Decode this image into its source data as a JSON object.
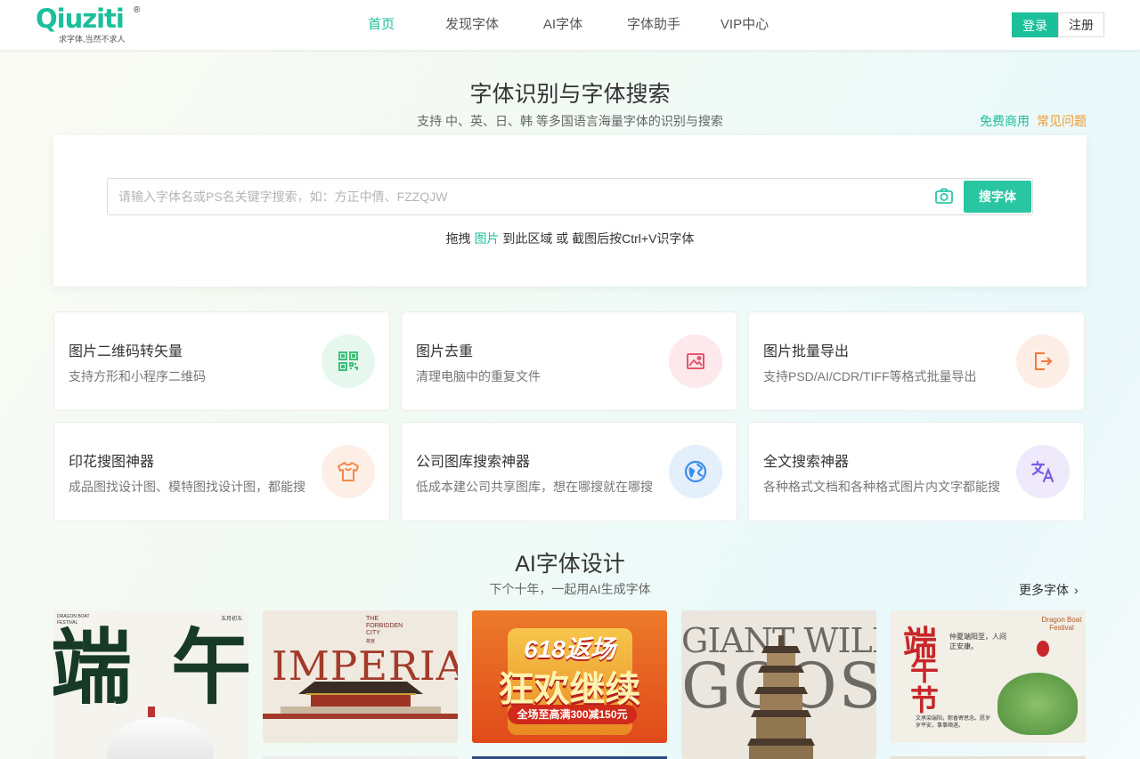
{
  "header": {
    "logo_text": "Qiuziti",
    "logo_reg": "®",
    "logo_slogan": "求字体,当然不求人",
    "nav": [
      {
        "label": "首页",
        "active": true
      },
      {
        "label": "发现字体",
        "active": false
      },
      {
        "label": "AI字体",
        "active": false
      },
      {
        "label": "字体助手",
        "active": false
      },
      {
        "label": "VIP中心",
        "active": false
      }
    ],
    "login_label": "登录",
    "register_label": "注册"
  },
  "hero": {
    "title": "字体识别与字体搜索",
    "subtitle": "支持 中、英、日、韩 等多国语言海量字体的识别与搜索",
    "free_link": "免费商用",
    "faq_link": "常见问题",
    "search_placeholder": "请输入字体名或PS名关键字搜索，如：方正中倩、FZZQJW",
    "search_button": "搜字体",
    "drag_pre": "拖拽",
    "drag_link": "图片",
    "drag_post": "到此区域 或 截图后按Ctrl+V识字体"
  },
  "tools": [
    {
      "title": "图片二维码转矢量",
      "desc": "支持方形和小程序二维码",
      "icon": "qrcode-icon",
      "color": "#3cbf7a",
      "bg": "#e6f7ee"
    },
    {
      "title": "图片去重",
      "desc": "清理电脑中的重复文件",
      "icon": "image-icon",
      "color": "#e8556a",
      "bg": "#fde8ec"
    },
    {
      "title": "图片批量导出",
      "desc": "支持PSD/AI/CDR/TIFF等格式批量导出",
      "icon": "export-icon",
      "color": "#f07a3a",
      "bg": "#fdeee5"
    },
    {
      "title": "印花搜图神器",
      "desc": "成品图找设计图、模特图找设计图，都能搜",
      "icon": "tshirt-icon",
      "color": "#f08a4a",
      "bg": "#fdefe6"
    },
    {
      "title": "公司图库搜索神器",
      "desc": "低成本建公司共享图库，想在哪搜就在哪搜",
      "icon": "globe-icon",
      "color": "#3d8ee8",
      "bg": "#e4effc"
    },
    {
      "title": "全文搜索神器",
      "desc": "各种格式文档和各种格式图片内文字都能搜",
      "icon": "translate-icon",
      "color": "#7a5ce0",
      "bg": "#eeeafc"
    }
  ],
  "ai_section": {
    "title": "AI字体设计",
    "subtitle": "下个十年，一起用AI生成字体",
    "more_label": "更多字体",
    "posters": [
      {
        "text_main": "端",
        "text_second": "午",
        "small_tl": "DRAGON BOAT FESTIVAL",
        "small_tr": "五月初五"
      },
      {
        "text_main": "IMPERIAL",
        "small_top": "THE FORBIDDEN CITY",
        "small_sub": "故宫"
      },
      {
        "text_main": "狂欢继续",
        "text_top": "618返场",
        "text_bottom": "全场至高满300减150元"
      },
      {
        "text_main": "GIANT WILD",
        "text_second": "GOOSE"
      },
      {
        "text_main": "端",
        "text_second": "午节",
        "small_tr": "Dragon Boat Festival",
        "poem": "仲夏端阳至，人间正安康。",
        "footer": "文承染端阳，粽香寄思念。愿岁岁平安，事事顺遂。"
      }
    ]
  }
}
